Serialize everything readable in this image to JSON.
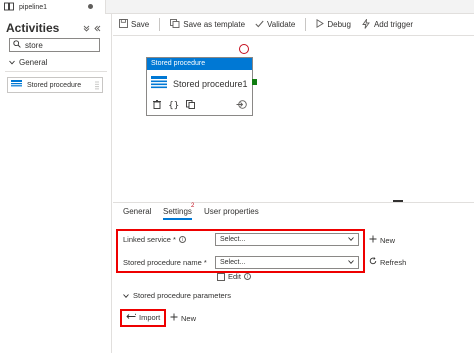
{
  "tab": {
    "name": "pipeline1"
  },
  "sidebar": {
    "title": "Activities",
    "search_value": "store",
    "group_label": "General",
    "item_label": "Stored procedure"
  },
  "toolbar": {
    "save": "Save",
    "save_as_template": "Save as template",
    "validate": "Validate",
    "debug": "Debug",
    "add_trigger": "Add trigger"
  },
  "node": {
    "header": "Stored procedure",
    "name": "Stored procedure1"
  },
  "panel": {
    "tabs": {
      "general": "General",
      "settings": "Settings",
      "settings_badge": "2",
      "user_properties": "User properties"
    },
    "linked_service_label": "Linked service *",
    "linked_service_value": "Select...",
    "new_label": "New",
    "sp_name_label": "Stored procedure name *",
    "sp_name_value": "Select...",
    "refresh_label": "Refresh",
    "edit_label": "Edit",
    "params_label": "Stored procedure parameters",
    "import_label": "Import",
    "new_param_label": "New"
  },
  "colors": {
    "accent": "#0078d4",
    "highlight": "#e00000",
    "error": "#c50f1f",
    "success": "#107c10"
  }
}
